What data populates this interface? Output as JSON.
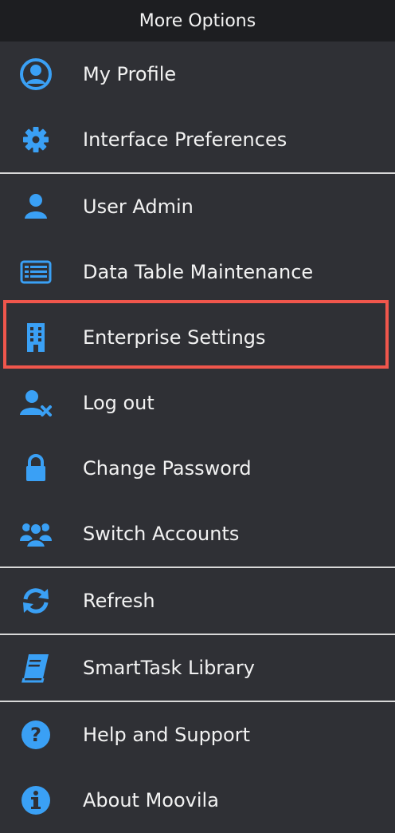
{
  "header": {
    "title": "More Options"
  },
  "accent_color": "#3aa0f5",
  "highlight_color": "#f0564c",
  "items": [
    {
      "label": "My Profile",
      "icon": "user-circle-icon"
    },
    {
      "label": "Interface Preferences",
      "icon": "gear-icon"
    },
    {
      "label": "User Admin",
      "icon": "user-icon"
    },
    {
      "label": "Data Table Maintenance",
      "icon": "table-icon"
    },
    {
      "label": "Enterprise Settings",
      "icon": "building-icon",
      "highlighted": true
    },
    {
      "label": "Log out",
      "icon": "user-remove-icon"
    },
    {
      "label": "Change Password",
      "icon": "lock-icon"
    },
    {
      "label": "Switch Accounts",
      "icon": "users-icon"
    },
    {
      "label": "Refresh",
      "icon": "refresh-icon"
    },
    {
      "label": "SmartTask Library",
      "icon": "book-icon"
    },
    {
      "label": "Help and Support",
      "icon": "question-circle-icon"
    },
    {
      "label": "About Moovila",
      "icon": "info-circle-icon"
    }
  ]
}
